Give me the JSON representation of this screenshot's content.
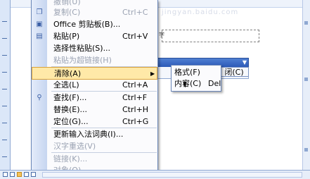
{
  "watermark": "jingyan.baidu.com",
  "document": {
    "line_text": "字"
  },
  "find_bar": {
    "dropdown_icon": "chevron-down-icon",
    "close_label": "闭(C)"
  },
  "edit_menu": {
    "items": [
      {
        "label": "撤销(U)",
        "shortcut": "",
        "disabled": true,
        "icon": "undo-icon"
      },
      {
        "label": "复制(C)",
        "shortcut": "Ctrl+C",
        "disabled": true,
        "icon": "copy-icon"
      },
      {
        "label": "Office 剪贴板(B)...",
        "shortcut": "",
        "disabled": false,
        "icon": "clipboard-icon"
      },
      {
        "label": "粘贴(P)",
        "shortcut": "Ctrl+V",
        "disabled": false,
        "icon": "paste-icon"
      },
      {
        "label": "选择性粘贴(S)...",
        "shortcut": "",
        "disabled": false,
        "icon": ""
      },
      {
        "label": "粘贴为超链接(H)",
        "shortcut": "",
        "disabled": true,
        "icon": ""
      },
      {
        "label": "清除(A)",
        "shortcut": "",
        "disabled": false,
        "icon": "",
        "highlighted": true,
        "submenu": true
      },
      {
        "label": "全选(L)",
        "shortcut": "Ctrl+A",
        "disabled": false,
        "icon": ""
      },
      {
        "label": "查找(F)...",
        "shortcut": "Ctrl+F",
        "disabled": false,
        "icon": "find-icon"
      },
      {
        "label": "替换(E)...",
        "shortcut": "Ctrl+H",
        "disabled": false,
        "icon": ""
      },
      {
        "label": "定位(G)...",
        "shortcut": "Ctrl+G",
        "disabled": false,
        "icon": ""
      },
      {
        "label": "更新输入法词典(I)...",
        "shortcut": "",
        "disabled": false,
        "icon": ""
      },
      {
        "label": "汉字重选(V)",
        "shortcut": "",
        "disabled": true,
        "icon": ""
      },
      {
        "label": "链接(K)...",
        "shortcut": "",
        "disabled": true,
        "icon": ""
      },
      {
        "label": "对象(O)",
        "shortcut": "",
        "disabled": true,
        "icon": ""
      }
    ]
  },
  "clear_submenu": {
    "items": [
      {
        "label": "格式(F)",
        "shortcut": ""
      },
      {
        "label": "内容(C)",
        "shortcut": "Del"
      }
    ]
  },
  "colors": {
    "highlight": "#ffe9a8",
    "menu_border": "#6a86b8",
    "gutter": "#c6d5f0"
  }
}
